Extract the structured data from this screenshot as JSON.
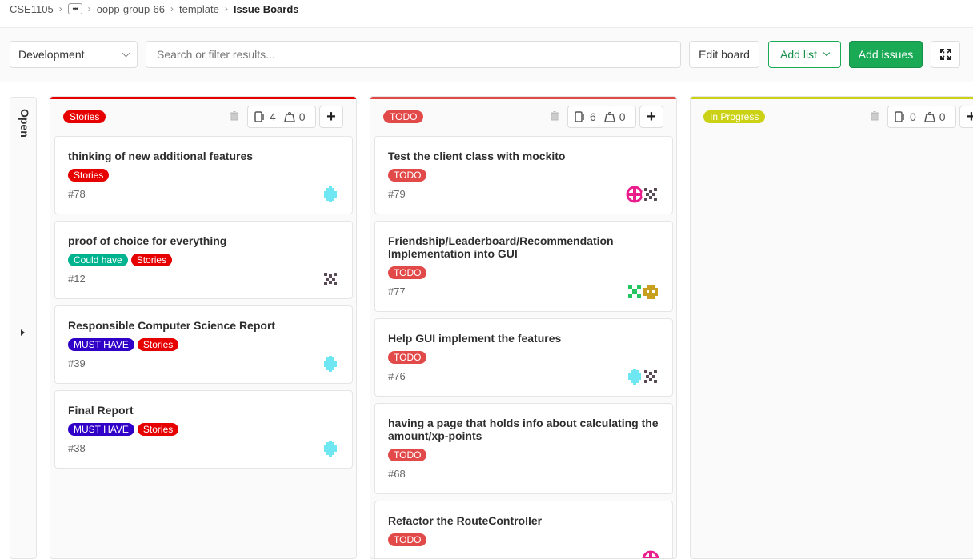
{
  "breadcrumb": {
    "group": "CSE1105",
    "more": "•••",
    "project": "oopp-group-66",
    "sub": "template",
    "current": "Issue Boards"
  },
  "toolbar": {
    "board_select": "Development",
    "search_placeholder": "Search or filter results...",
    "edit_board": "Edit board",
    "add_list": "Add list",
    "add_issues": "Add issues"
  },
  "colors": {
    "stories": "#e60000",
    "todo": "#e24a4a",
    "in_progress": "#cbd216",
    "could_have": "#00b38f",
    "must_have": "#3000c8",
    "green": "#1aaa55"
  },
  "open_column": {
    "label": "Open"
  },
  "lists": [
    {
      "label": "Stories",
      "issues": "4",
      "weight": "0",
      "cards": [
        {
          "title": "thinking of new additional features",
          "labels": [
            "Stories"
          ],
          "number": "#78",
          "avatars": [
            "cyan"
          ]
        },
        {
          "title": "proof of choice for everything",
          "labels": [
            "Could have",
            "Stories"
          ],
          "number": "#12",
          "avatars": [
            "dark"
          ]
        },
        {
          "title": "Responsible Computer Science Report",
          "labels": [
            "MUST HAVE",
            "Stories"
          ],
          "number": "#39",
          "avatars": [
            "cyan"
          ]
        },
        {
          "title": "Final Report",
          "labels": [
            "MUST HAVE",
            "Stories"
          ],
          "number": "#38",
          "avatars": [
            "cyan"
          ]
        }
      ]
    },
    {
      "label": "TODO",
      "issues": "6",
      "weight": "0",
      "cards": [
        {
          "title": "Test the client class with mockito",
          "labels": [
            "TODO"
          ],
          "number": "#79",
          "avatars": [
            "magenta",
            "dark"
          ]
        },
        {
          "title": "Friendship/Leaderboard/Recommendation Implementation into GUI",
          "labels": [
            "TODO"
          ],
          "number": "#77",
          "avatars": [
            "green",
            "gold"
          ]
        },
        {
          "title": "Help GUI implement the features",
          "labels": [
            "TODO"
          ],
          "number": "#76",
          "avatars": [
            "cyan",
            "dark"
          ]
        },
        {
          "title": "having a page that holds info about calculating the amount/xp-points",
          "labels": [
            "TODO"
          ],
          "number": "#68",
          "avatars": []
        },
        {
          "title": "Refactor the RouteController",
          "labels": [
            "TODO"
          ],
          "number": "",
          "avatars": [
            "magenta"
          ]
        }
      ]
    },
    {
      "label": "In Progress",
      "issues": "0",
      "weight": "0",
      "cards": []
    }
  ]
}
